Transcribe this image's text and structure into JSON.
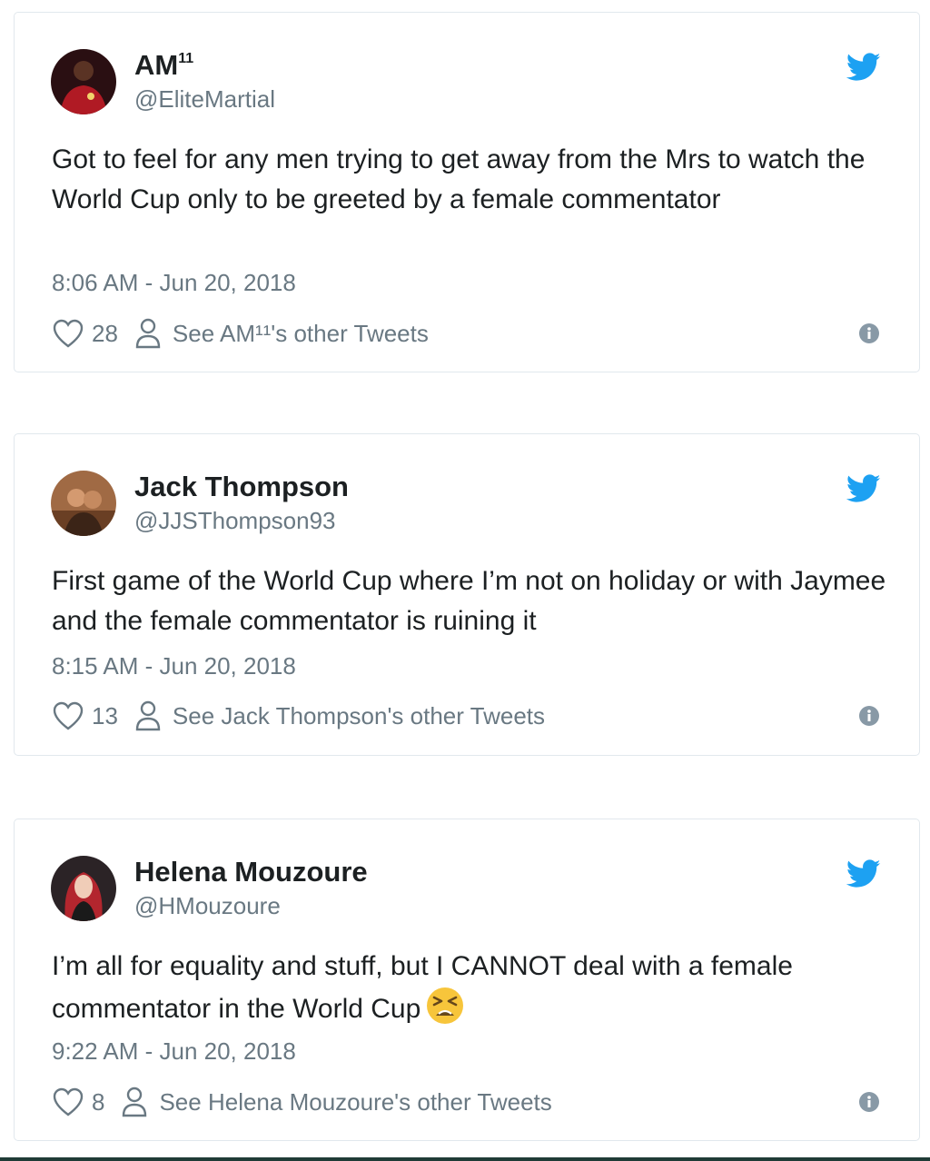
{
  "colors": {
    "twitter_blue": "#1da1f2",
    "muted": "#697882",
    "text": "#1c2022",
    "border": "#e1e8ed"
  },
  "tweets": [
    {
      "name": "AM",
      "name_sup": "11",
      "handle": "@EliteMartial",
      "text": "Got to feel for any men trying to get away from the Mrs to watch the World Cup only to be greeted by a female commentator",
      "time": "8:06 AM - Jun 20, 2018",
      "likes": "28",
      "other_tweets": "See AM¹¹'s other Tweets"
    },
    {
      "name": "Jack Thompson",
      "handle": "@JJSThompson93",
      "text": "First game of the World Cup where I’m not on holiday or with Jaymee and the female commentator is ruining it",
      "time": "8:15 AM - Jun 20, 2018",
      "likes": "13",
      "other_tweets": "See Jack Thompson's other Tweets"
    },
    {
      "name": "Helena Mouzoure",
      "handle": "@HMouzoure",
      "text": "I’m all for equality and stuff, but I CANNOT deal with a female commentator in the World Cup",
      "emoji": "tired-face-emoji",
      "time": "9:22 AM - Jun 20, 2018",
      "likes": "8",
      "other_tweets": "See Helena Mouzoure's other Tweets"
    }
  ]
}
